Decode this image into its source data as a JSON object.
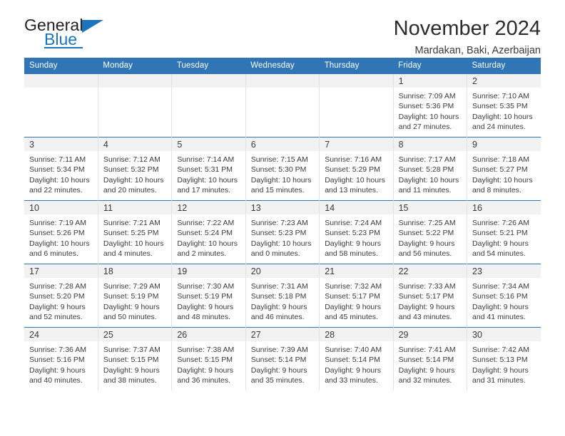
{
  "brand": {
    "name_part1": "General",
    "name_part2": "Blue",
    "accent_color": "#1c75bc"
  },
  "header": {
    "title": "November 2024",
    "location": "Mardakan, Baki, Azerbaijan"
  },
  "calendar": {
    "header_color": "#3075b5",
    "weekdays": [
      "Sunday",
      "Monday",
      "Tuesday",
      "Wednesday",
      "Thursday",
      "Friday",
      "Saturday"
    ],
    "weeks": [
      [
        {
          "day": "",
          "blank": true
        },
        {
          "day": "",
          "blank": true
        },
        {
          "day": "",
          "blank": true
        },
        {
          "day": "",
          "blank": true
        },
        {
          "day": "",
          "blank": true
        },
        {
          "day": "1",
          "sunrise": "Sunrise: 7:09 AM",
          "sunset": "Sunset: 5:36 PM",
          "daylight": "Daylight: 10 hours and 27 minutes."
        },
        {
          "day": "2",
          "sunrise": "Sunrise: 7:10 AM",
          "sunset": "Sunset: 5:35 PM",
          "daylight": "Daylight: 10 hours and 24 minutes."
        }
      ],
      [
        {
          "day": "3",
          "sunrise": "Sunrise: 7:11 AM",
          "sunset": "Sunset: 5:34 PM",
          "daylight": "Daylight: 10 hours and 22 minutes."
        },
        {
          "day": "4",
          "sunrise": "Sunrise: 7:12 AM",
          "sunset": "Sunset: 5:32 PM",
          "daylight": "Daylight: 10 hours and 20 minutes."
        },
        {
          "day": "5",
          "sunrise": "Sunrise: 7:14 AM",
          "sunset": "Sunset: 5:31 PM",
          "daylight": "Daylight: 10 hours and 17 minutes."
        },
        {
          "day": "6",
          "sunrise": "Sunrise: 7:15 AM",
          "sunset": "Sunset: 5:30 PM",
          "daylight": "Daylight: 10 hours and 15 minutes."
        },
        {
          "day": "7",
          "sunrise": "Sunrise: 7:16 AM",
          "sunset": "Sunset: 5:29 PM",
          "daylight": "Daylight: 10 hours and 13 minutes."
        },
        {
          "day": "8",
          "sunrise": "Sunrise: 7:17 AM",
          "sunset": "Sunset: 5:28 PM",
          "daylight": "Daylight: 10 hours and 11 minutes."
        },
        {
          "day": "9",
          "sunrise": "Sunrise: 7:18 AM",
          "sunset": "Sunset: 5:27 PM",
          "daylight": "Daylight: 10 hours and 8 minutes."
        }
      ],
      [
        {
          "day": "10",
          "sunrise": "Sunrise: 7:19 AM",
          "sunset": "Sunset: 5:26 PM",
          "daylight": "Daylight: 10 hours and 6 minutes."
        },
        {
          "day": "11",
          "sunrise": "Sunrise: 7:21 AM",
          "sunset": "Sunset: 5:25 PM",
          "daylight": "Daylight: 10 hours and 4 minutes."
        },
        {
          "day": "12",
          "sunrise": "Sunrise: 7:22 AM",
          "sunset": "Sunset: 5:24 PM",
          "daylight": "Daylight: 10 hours and 2 minutes."
        },
        {
          "day": "13",
          "sunrise": "Sunrise: 7:23 AM",
          "sunset": "Sunset: 5:23 PM",
          "daylight": "Daylight: 10 hours and 0 minutes."
        },
        {
          "day": "14",
          "sunrise": "Sunrise: 7:24 AM",
          "sunset": "Sunset: 5:23 PM",
          "daylight": "Daylight: 9 hours and 58 minutes."
        },
        {
          "day": "15",
          "sunrise": "Sunrise: 7:25 AM",
          "sunset": "Sunset: 5:22 PM",
          "daylight": "Daylight: 9 hours and 56 minutes."
        },
        {
          "day": "16",
          "sunrise": "Sunrise: 7:26 AM",
          "sunset": "Sunset: 5:21 PM",
          "daylight": "Daylight: 9 hours and 54 minutes."
        }
      ],
      [
        {
          "day": "17",
          "sunrise": "Sunrise: 7:28 AM",
          "sunset": "Sunset: 5:20 PM",
          "daylight": "Daylight: 9 hours and 52 minutes."
        },
        {
          "day": "18",
          "sunrise": "Sunrise: 7:29 AM",
          "sunset": "Sunset: 5:19 PM",
          "daylight": "Daylight: 9 hours and 50 minutes."
        },
        {
          "day": "19",
          "sunrise": "Sunrise: 7:30 AM",
          "sunset": "Sunset: 5:19 PM",
          "daylight": "Daylight: 9 hours and 48 minutes."
        },
        {
          "day": "20",
          "sunrise": "Sunrise: 7:31 AM",
          "sunset": "Sunset: 5:18 PM",
          "daylight": "Daylight: 9 hours and 46 minutes."
        },
        {
          "day": "21",
          "sunrise": "Sunrise: 7:32 AM",
          "sunset": "Sunset: 5:17 PM",
          "daylight": "Daylight: 9 hours and 45 minutes."
        },
        {
          "day": "22",
          "sunrise": "Sunrise: 7:33 AM",
          "sunset": "Sunset: 5:17 PM",
          "daylight": "Daylight: 9 hours and 43 minutes."
        },
        {
          "day": "23",
          "sunrise": "Sunrise: 7:34 AM",
          "sunset": "Sunset: 5:16 PM",
          "daylight": "Daylight: 9 hours and 41 minutes."
        }
      ],
      [
        {
          "day": "24",
          "sunrise": "Sunrise: 7:36 AM",
          "sunset": "Sunset: 5:16 PM",
          "daylight": "Daylight: 9 hours and 40 minutes."
        },
        {
          "day": "25",
          "sunrise": "Sunrise: 7:37 AM",
          "sunset": "Sunset: 5:15 PM",
          "daylight": "Daylight: 9 hours and 38 minutes."
        },
        {
          "day": "26",
          "sunrise": "Sunrise: 7:38 AM",
          "sunset": "Sunset: 5:15 PM",
          "daylight": "Daylight: 9 hours and 36 minutes."
        },
        {
          "day": "27",
          "sunrise": "Sunrise: 7:39 AM",
          "sunset": "Sunset: 5:14 PM",
          "daylight": "Daylight: 9 hours and 35 minutes."
        },
        {
          "day": "28",
          "sunrise": "Sunrise: 7:40 AM",
          "sunset": "Sunset: 5:14 PM",
          "daylight": "Daylight: 9 hours and 33 minutes."
        },
        {
          "day": "29",
          "sunrise": "Sunrise: 7:41 AM",
          "sunset": "Sunset: 5:14 PM",
          "daylight": "Daylight: 9 hours and 32 minutes."
        },
        {
          "day": "30",
          "sunrise": "Sunrise: 7:42 AM",
          "sunset": "Sunset: 5:13 PM",
          "daylight": "Daylight: 9 hours and 31 minutes."
        }
      ]
    ]
  }
}
